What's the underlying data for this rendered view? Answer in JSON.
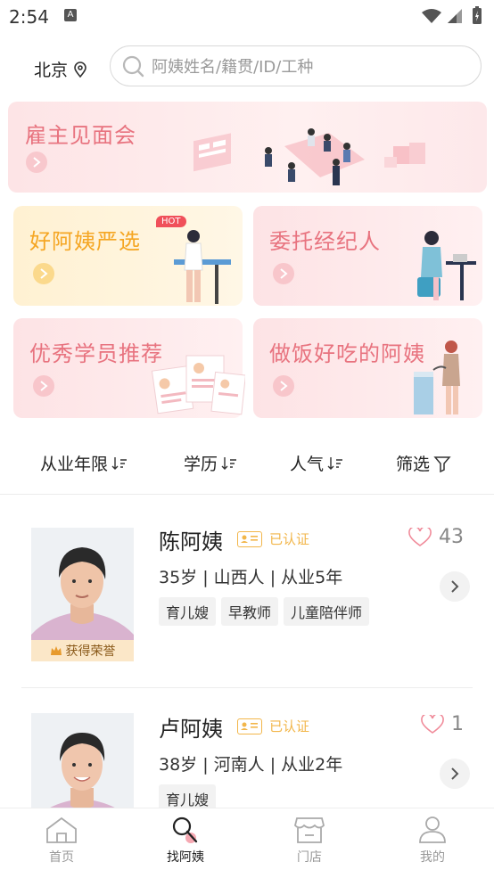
{
  "status_bar": {
    "time": "2:54",
    "a_badge": "A"
  },
  "header": {
    "city": "北京",
    "search_placeholder": "阿姨姓名/籍贯/ID/工种"
  },
  "banner": {
    "title": "雇主见面会"
  },
  "cards": [
    {
      "title": "好阿姨严选",
      "badge": "HOT"
    },
    {
      "title": "委托经纪人"
    },
    {
      "title": "优秀学员推荐"
    },
    {
      "title": "做饭好吃的阿姨"
    }
  ],
  "filters": [
    {
      "label": "从业年限"
    },
    {
      "label": "学历"
    },
    {
      "label": "人气"
    },
    {
      "label": "筛选"
    }
  ],
  "profiles": [
    {
      "name": "陈阿姨",
      "verified": "已认证",
      "likes": "43",
      "info": "35岁 | 山西人 | 从业5年",
      "tags": [
        "育儿嫂",
        "早教师",
        "儿童陪伴师"
      ],
      "honor": "获得荣誉"
    },
    {
      "name": "卢阿姨",
      "verified": "已认证",
      "likes": "1",
      "info": "38岁 | 河南人 | 从业2年",
      "tags": [
        "育儿嫂"
      ]
    }
  ],
  "nav": [
    {
      "label": "首页"
    },
    {
      "label": "找阿姨"
    },
    {
      "label": "门店"
    },
    {
      "label": "我的"
    }
  ],
  "colors": {
    "accent_pink": "#e8737f",
    "accent_yellow": "#f5a623",
    "verified": "#f2b64a"
  }
}
